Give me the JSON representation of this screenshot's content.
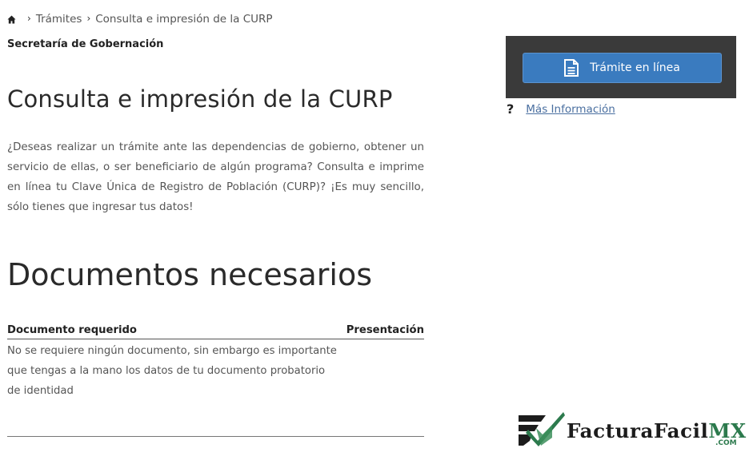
{
  "breadcrumb": {
    "home_icon": "home-icon",
    "items": [
      "Trámites",
      "Consulta e impresión de la CURP"
    ]
  },
  "agency": "Secretaría de Gobernación",
  "page_title": "Consulta e impresión de la CURP",
  "intro": "¿Deseas realizar un trámite ante las dependencias de gobierno, obtener un servicio de ellas, o ser beneficiario de algún programa? Consulta e imprime en línea tu Clave Única de Registro de Población (CURP)? ¡Es muy sencillo, sólo tienes que ingresar tus datos!",
  "documents": {
    "title": "Documentos necesarios",
    "columns": [
      "Documento requerido",
      "Presentación"
    ],
    "rows": [
      {
        "requerido": "No se requiere ningún documento, sin embargo es importante que tengas a la mano los datos de tu documento probatorio de identidad",
        "presentacion": ""
      }
    ]
  },
  "action_panel": {
    "button_label": "Trámite en línea",
    "button_icon": "document-icon",
    "panel_color": "#3a3a3a",
    "button_color": "#3a7bbf"
  },
  "more_info": {
    "icon": "?",
    "label": "Más Información"
  },
  "watermark": {
    "name": "FacturaFacil",
    "suffix": "MX",
    "domain": ".COM",
    "accent_color": "#2c7a4d"
  }
}
